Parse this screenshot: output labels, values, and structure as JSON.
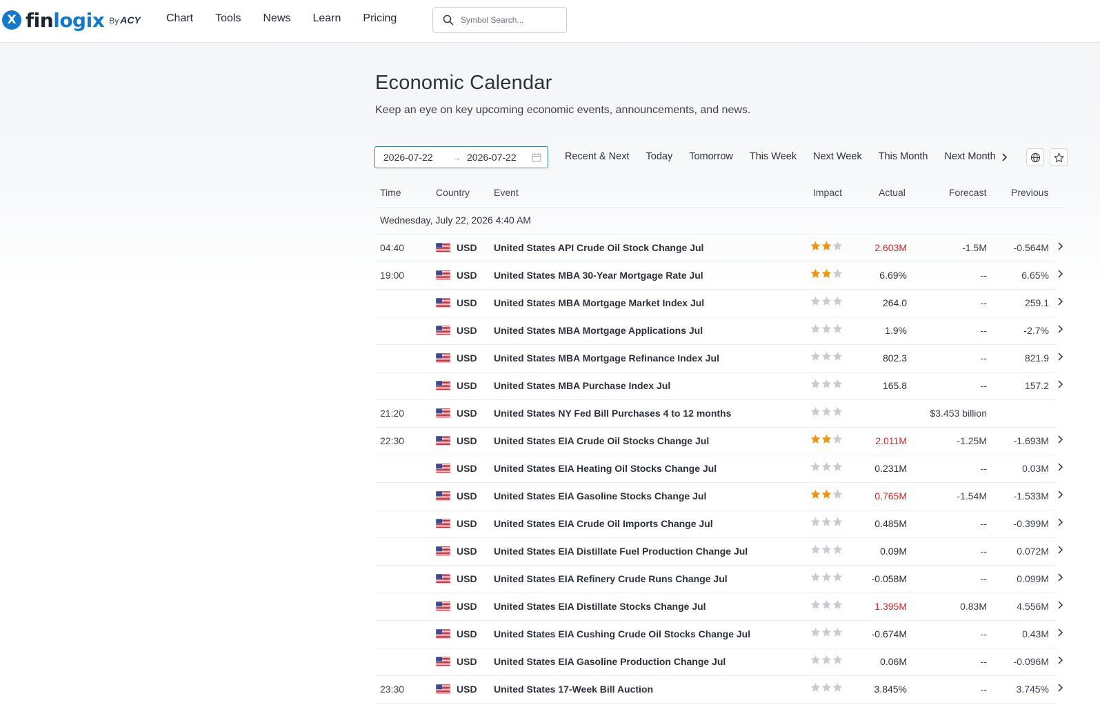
{
  "header": {
    "logo": {
      "mark": "X",
      "fin": "fin",
      "logix": "logix",
      "by": "By",
      "acy": "ACY"
    },
    "nav": [
      "Chart",
      "Tools",
      "News",
      "Learn",
      "Pricing"
    ],
    "search": {
      "placeholder": "Symbol Search...",
      "icon": "search-icon"
    }
  },
  "page": {
    "title": "Economic Calendar",
    "subtitle": "Keep an eye on key upcoming economic events, announcements, and news."
  },
  "toolbar": {
    "date_from": "2026-07-22",
    "date_to": "2026-07-22",
    "filters": [
      "Recent & Next",
      "Today",
      "Tomorrow",
      "This Week",
      "Next Week",
      "This Month",
      "Next Month"
    ],
    "icons": [
      "calendar-icon",
      "chevron-right-icon",
      "globe-icon",
      "star-icon"
    ]
  },
  "table": {
    "columns": {
      "time": "Time",
      "country": "Country",
      "event": "Event",
      "impact": "Impact",
      "actual": "Actual",
      "forecast": "Forecast",
      "previous": "Previous"
    },
    "group_label": "Wednesday, July 22, 2026 4:40 AM",
    "colors": {
      "star_on": "#f0940a",
      "star_off": "#c8ccd1",
      "actual_red": "#e02424"
    },
    "rows": [
      {
        "time": "04:40",
        "currency": "USD",
        "event": "United States API Crude Oil Stock Change Jul",
        "impact": 2,
        "actual": "2.603M",
        "actual_red": true,
        "forecast": "-1.5M",
        "previous": "-0.564M",
        "chevron": true
      },
      {
        "time": "19:00",
        "currency": "USD",
        "event": "United States MBA 30-Year Mortgage Rate Jul",
        "impact": 2,
        "actual": "6.69%",
        "actual_red": false,
        "forecast": "--",
        "previous": "6.65%",
        "chevron": true
      },
      {
        "time": "",
        "currency": "USD",
        "event": "United States MBA Mortgage Market Index Jul",
        "impact": 0,
        "actual": "264.0",
        "actual_red": false,
        "forecast": "--",
        "previous": "259.1",
        "chevron": true
      },
      {
        "time": "",
        "currency": "USD",
        "event": "United States MBA Mortgage Applications Jul",
        "impact": 0,
        "actual": "1.9%",
        "actual_red": false,
        "forecast": "--",
        "previous": "-2.7%",
        "chevron": true
      },
      {
        "time": "",
        "currency": "USD",
        "event": "United States MBA Mortgage Refinance Index Jul",
        "impact": 0,
        "actual": "802.3",
        "actual_red": false,
        "forecast": "--",
        "previous": "821.9",
        "chevron": true
      },
      {
        "time": "",
        "currency": "USD",
        "event": "United States MBA Purchase Index Jul",
        "impact": 0,
        "actual": "165.8",
        "actual_red": false,
        "forecast": "--",
        "previous": "157.2",
        "chevron": true
      },
      {
        "time": "21:20",
        "currency": "USD",
        "event": "United States NY Fed Bill Purchases 4 to 12 months",
        "impact": 0,
        "actual": "",
        "actual_red": false,
        "forecast": "$3.453 billion",
        "previous": "",
        "chevron": false
      },
      {
        "time": "22:30",
        "currency": "USD",
        "event": "United States EIA Crude Oil Stocks Change Jul",
        "impact": 2,
        "actual": "2.011M",
        "actual_red": true,
        "forecast": "-1.25M",
        "previous": "-1.693M",
        "chevron": true
      },
      {
        "time": "",
        "currency": "USD",
        "event": "United States EIA Heating Oil Stocks Change Jul",
        "impact": 0,
        "actual": "0.231M",
        "actual_red": false,
        "forecast": "--",
        "previous": "0.03M",
        "chevron": true
      },
      {
        "time": "",
        "currency": "USD",
        "event": "United States EIA Gasoline Stocks Change Jul",
        "impact": 2,
        "actual": "0.765M",
        "actual_red": true,
        "forecast": "-1.54M",
        "previous": "-1.533M",
        "chevron": true
      },
      {
        "time": "",
        "currency": "USD",
        "event": "United States EIA Crude Oil Imports Change Jul",
        "impact": 0,
        "actual": "0.485M",
        "actual_red": false,
        "forecast": "--",
        "previous": "-0.399M",
        "chevron": true
      },
      {
        "time": "",
        "currency": "USD",
        "event": "United States EIA Distillate Fuel Production Change Jul",
        "impact": 0,
        "actual": "0.09M",
        "actual_red": false,
        "forecast": "--",
        "previous": "0.072M",
        "chevron": true
      },
      {
        "time": "",
        "currency": "USD",
        "event": "United States EIA Refinery Crude Runs Change Jul",
        "impact": 0,
        "actual": "-0.058M",
        "actual_red": false,
        "forecast": "--",
        "previous": "0.099M",
        "chevron": true
      },
      {
        "time": "",
        "currency": "USD",
        "event": "United States EIA Distillate Stocks Change Jul",
        "impact": 0,
        "actual": "1.395M",
        "actual_red": true,
        "forecast": "0.83M",
        "previous": "4.556M",
        "chevron": true
      },
      {
        "time": "",
        "currency": "USD",
        "event": "United States EIA Cushing Crude Oil Stocks Change Jul",
        "impact": 0,
        "actual": "-0.674M",
        "actual_red": false,
        "forecast": "--",
        "previous": "0.43M",
        "chevron": true
      },
      {
        "time": "",
        "currency": "USD",
        "event": "United States EIA Gasoline Production Change Jul",
        "impact": 0,
        "actual": "0.06M",
        "actual_red": false,
        "forecast": "--",
        "previous": "-0.096M",
        "chevron": true
      },
      {
        "time": "23:30",
        "currency": "USD",
        "event": "United States 17-Week Bill Auction",
        "impact": 0,
        "actual": "3.845%",
        "actual_red": false,
        "forecast": "--",
        "previous": "3.745%",
        "chevron": true
      }
    ]
  }
}
